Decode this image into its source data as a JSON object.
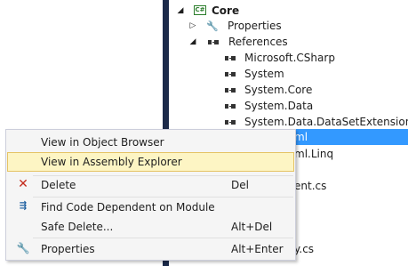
{
  "tree": {
    "project": {
      "label": "Core",
      "icon": "csharp-project-icon",
      "badge": "C#"
    },
    "properties": {
      "label": "Properties",
      "icon": "wrench-icon"
    },
    "references": {
      "label": "References",
      "icon": "references-icon"
    },
    "reference_items": [
      "Microsoft.CSharp",
      "System",
      "System.Core",
      "System.Data",
      "System.Data.DataSetExtensions"
    ],
    "partial_items": [
      "ml",
      "ml.Linq",
      "ent.cs",
      "y.cs"
    ]
  },
  "context_menu": {
    "items": [
      {
        "label": "View in Object Browser",
        "shortcut": "",
        "icon": ""
      },
      {
        "label": "View in Assembly Explorer",
        "shortcut": "",
        "icon": "",
        "hover": true
      },
      {
        "label": "Delete",
        "shortcut": "Del",
        "icon": "delete-icon"
      },
      {
        "label": "Find Code Dependent on Module",
        "shortcut": "",
        "icon": "find-dependent-icon"
      },
      {
        "label": "Safe Delete...",
        "shortcut": "Alt+Del",
        "icon": ""
      },
      {
        "label": "Properties",
        "shortcut": "Alt+Enter",
        "icon": "wrench-icon"
      }
    ]
  },
  "colors": {
    "selection": "#3399ff",
    "menu_hover": "#fdf5c4",
    "margin": "#1c2a4a"
  }
}
